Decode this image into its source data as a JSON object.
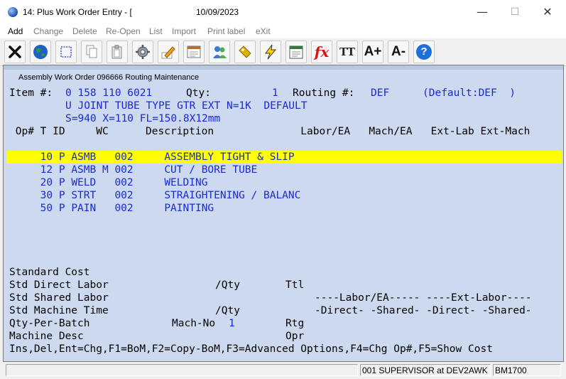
{
  "window": {
    "title": "14: Plus Work Order Entry - [",
    "date": "10/09/2023",
    "minimize": "—",
    "maximize": "☐",
    "close": "✕"
  },
  "menu": [
    "Add",
    "Change",
    "Delete",
    "Re-Open",
    "List",
    "Import",
    "Print label",
    "eXit"
  ],
  "toolbar_icons": [
    "close-x-icon",
    "globe-icon",
    "select-box-icon",
    "copy-icon",
    "paste-icon",
    "settings-gear-icon",
    "edit-pencil-icon",
    "form-icon",
    "users-icon",
    "tag-icon",
    "lightning-icon",
    "calendar-icon",
    "function-fx-icon",
    "font-size-icon",
    "font-increase-icon",
    "font-decrease-icon",
    "help-icon"
  ],
  "toolbar_text": {
    "fx": "fx",
    "tt": "TT",
    "a_plus": "A+",
    "a_minus": "A-",
    "help": "?"
  },
  "panel": {
    "title": "Assembly Work Order 096666 Routing Maintenance",
    "item_label": "Item #:",
    "item_value": "0 158 110 6021",
    "qty_label": "Qty:",
    "qty_value": "1",
    "routing_label": "Routing #:",
    "routing_value": "DEF",
    "routing_default": "(Default:DEF  )",
    "desc_line1": "U JOINT TUBE TYPE GTR EXT N=1K  DEFAULT",
    "desc_line2": "S=940 X=110 FL=150.8X12mm"
  },
  "ops_header": " Op# T ID     WC      Description              Labor/EA   Mach/EA   Ext-Lab Ext-Mach",
  "ops": [
    {
      "op": " 10",
      "t": "P",
      "id": "ASMB  ",
      "wc": "002",
      "desc": "ASSEMBLY TIGHT & SLIP",
      "selected": false
    },
    {
      "op": " 12",
      "t": "P",
      "id": "ASMB M",
      "wc": "002",
      "desc": "CUT / BORE TUBE",
      "selected": true
    },
    {
      "op": " 20",
      "t": "P",
      "id": "WELD  ",
      "wc": "002",
      "desc": "WELDING",
      "selected": false
    },
    {
      "op": " 30",
      "t": "P",
      "id": "STRT  ",
      "wc": "002",
      "desc": "STRAIGHTENING / BALANC",
      "selected": false
    },
    {
      "op": " 50",
      "t": "P",
      "id": "PAIN  ",
      "wc": "002",
      "desc": "PAINTING",
      "selected": false
    }
  ],
  "cost": {
    "heading": "Standard Cost",
    "direct_labor": "Std Direct Labor",
    "per_qty_1": "/Qty",
    "ttl": "Ttl",
    "shared_labor": "Std Shared Labor",
    "labor_ea_header": "----Labor/EA----- ----Ext-Labor----",
    "machine_time": "Std Machine Time",
    "per_qty_2": "/Qty",
    "direct_shared_header": "-Direct- -Shared- -Direct- -Shared-",
    "qty_per_batch": "Qty-Per-Batch",
    "mach_no_label": "Mach-No",
    "mach_no_value": "1",
    "rtg": "Rtg",
    "machine_desc": "Machine Desc",
    "opr": "Opr"
  },
  "help_line": "Ins,Del,Ent=Chg,F1=BoM,F2=Copy-BoM,F3=Advanced Options,F4=Chg Op#,F5=Show Cost",
  "status": {
    "user": "001 SUPERVISOR at DEV2AWK",
    "code": "BM1700"
  }
}
